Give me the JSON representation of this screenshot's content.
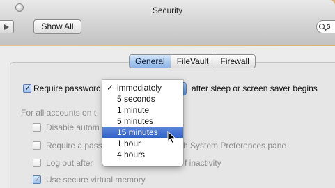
{
  "window": {
    "title": "Security"
  },
  "toolbar": {
    "show_all_label": "Show All",
    "search_value": "s",
    "back_icon": "back-icon",
    "search_icon": "search-icon"
  },
  "tabs": [
    {
      "label": "General",
      "selected": true
    },
    {
      "label": "FileVault",
      "selected": false
    },
    {
      "label": "Firewall",
      "selected": false
    }
  ],
  "general": {
    "require_password": {
      "label": "Require passworc",
      "checked": true,
      "suffix": "after sleep or screen saver begins"
    },
    "all_accounts_label": "For all accounts on t",
    "disable_auto": {
      "label": "Disable autom",
      "checked": false
    },
    "require_pass_pane": {
      "label": "Require a pass",
      "suffix": "h System Preferences pane",
      "checked": false
    },
    "logout_after": {
      "label": "Log out after",
      "suffix": "f inactivity",
      "checked": false
    },
    "secure_vm": {
      "label": "Use secure virtual memory",
      "checked": true
    }
  },
  "password_delay_menu": {
    "checked_item": "immediately",
    "highlighted_item": "15 minutes",
    "items": [
      "immediately",
      "5 seconds",
      "1 minute",
      "5 minutes",
      "15 minutes",
      "1 hour",
      "4 hours"
    ],
    "checkmark": "✓"
  },
  "colors": {
    "accent": "#2f62c8",
    "desktop": "#dcb67e"
  }
}
